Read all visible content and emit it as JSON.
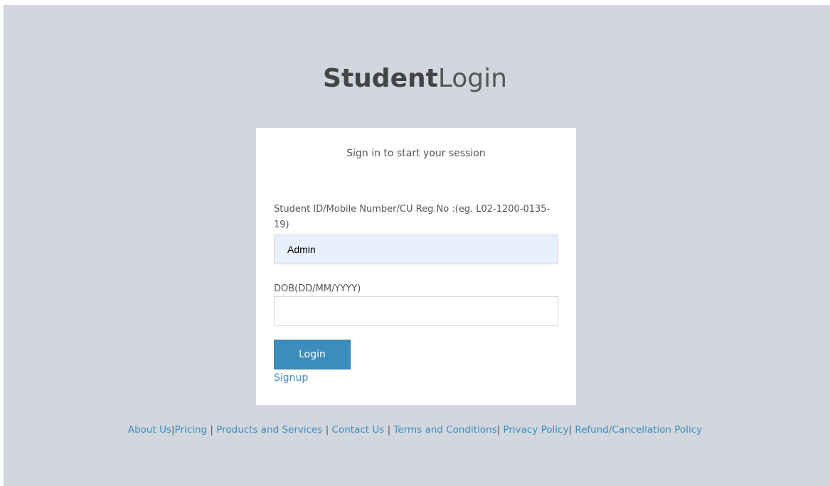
{
  "brand": {
    "bold": "Student",
    "light": "Login"
  },
  "login_box": {
    "message": "Sign in to start your session",
    "id_field": {
      "label": "Student ID/Mobile Number/CU Reg.No :(eg. L02-1200-0135-19)",
      "value": "Admin"
    },
    "dob_field": {
      "label": "DOB(DD/MM/YYYY)",
      "value": ""
    },
    "login_button": "Login",
    "signup_link": "Signup"
  },
  "footer": {
    "about": "About Us",
    "sep1": "|",
    "pricing": "Pricing",
    "sep2": " | ",
    "products": "Products and Services",
    "sep3": " | ",
    "contact": "Contact Us",
    "sep4": " | ",
    "terms": "Terms and Conditions",
    "sep5": "| ",
    "privacy": "Privacy Policy",
    "sep6": "| ",
    "refund": "Refund/Cancellation Policy"
  },
  "colors": {
    "background": "#d2d6de",
    "primary": "#3c8dbc",
    "autofill": "#e8f0fe"
  }
}
